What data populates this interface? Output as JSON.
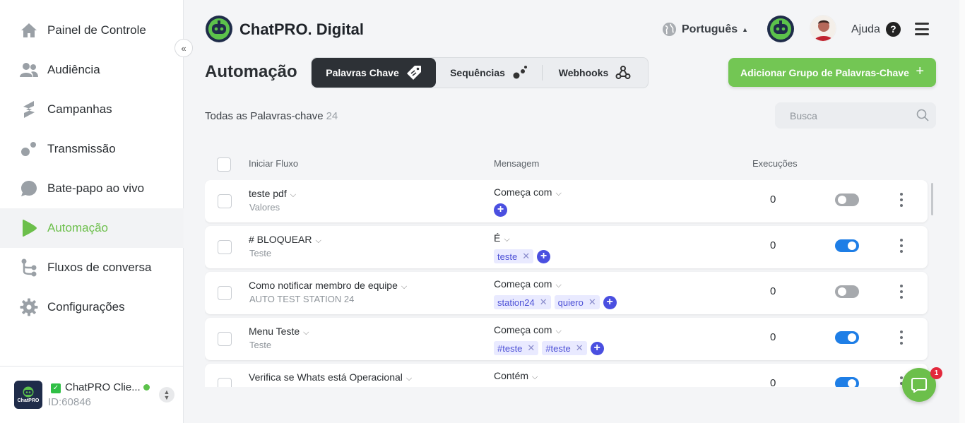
{
  "sidebar": {
    "items": [
      {
        "label": "Painel de Controle",
        "icon": "home-icon"
      },
      {
        "label": "Audiência",
        "icon": "users-icon"
      },
      {
        "label": "Campanhas",
        "icon": "campaign-icon"
      },
      {
        "label": "Transmissão",
        "icon": "broadcast-icon"
      },
      {
        "label": "Bate-papo ao vivo",
        "icon": "chat-bubble-icon"
      },
      {
        "label": "Automação",
        "icon": "play-icon",
        "active": true
      },
      {
        "label": "Fluxos de conversa",
        "icon": "flow-icon"
      },
      {
        "label": "Configurações",
        "icon": "gear-icon"
      }
    ],
    "collapse_glyph": "«",
    "account": {
      "name": "ChatPRO Clie...",
      "id": "ID:60846",
      "logo_text": "ChatPRO"
    }
  },
  "header": {
    "brand": "ChatPRO. Digital",
    "language": "Português",
    "help": "Ajuda",
    "help_glyph": "?"
  },
  "page": {
    "title": "Automação",
    "tabs": [
      {
        "label": "Palavras Chave",
        "icon": "tag-icon",
        "active": true
      },
      {
        "label": "Sequências",
        "icon": "sequence-icon"
      },
      {
        "label": "Webhooks",
        "icon": "webhook-icon"
      }
    ],
    "add_button": "Adicionar Grupo de Palavras-Chave",
    "add_glyph": "+",
    "count_label": "Todas as Palavras-chave",
    "count": "24",
    "search_placeholder": "Busca"
  },
  "table": {
    "headers": {
      "flow": "Iniciar Fluxo",
      "message": "Mensagem",
      "runs": "Execuções"
    },
    "rows": [
      {
        "flow": "teste pdf",
        "sub": "Valores",
        "match": "Começa com",
        "keywords": [],
        "runs": "0",
        "enabled": false
      },
      {
        "flow": "# BLOQUEAR",
        "sub": "Teste",
        "match": "É",
        "keywords": [
          "teste"
        ],
        "runs": "0",
        "enabled": true
      },
      {
        "flow": "Como notificar membro de equipe",
        "sub": "AUTO TEST STATION 24",
        "match": "Começa com",
        "keywords": [
          "station24",
          "quiero"
        ],
        "runs": "0",
        "enabled": false
      },
      {
        "flow": "Menu Teste",
        "sub": "Teste",
        "match": "Começa com",
        "keywords": [
          "#teste",
          "#teste"
        ],
        "runs": "0",
        "enabled": true
      },
      {
        "flow": "Verifica se Whats está Operacional",
        "sub": "",
        "match": "Contém",
        "keywords": [],
        "runs": "0",
        "enabled": true
      }
    ]
  },
  "chat_widget": {
    "badge": "1"
  },
  "colors": {
    "accent": "#73c654",
    "toggle_on": "#1e7ee6",
    "chip": "#4b4fd6",
    "dark_tab": "#2d3136"
  }
}
